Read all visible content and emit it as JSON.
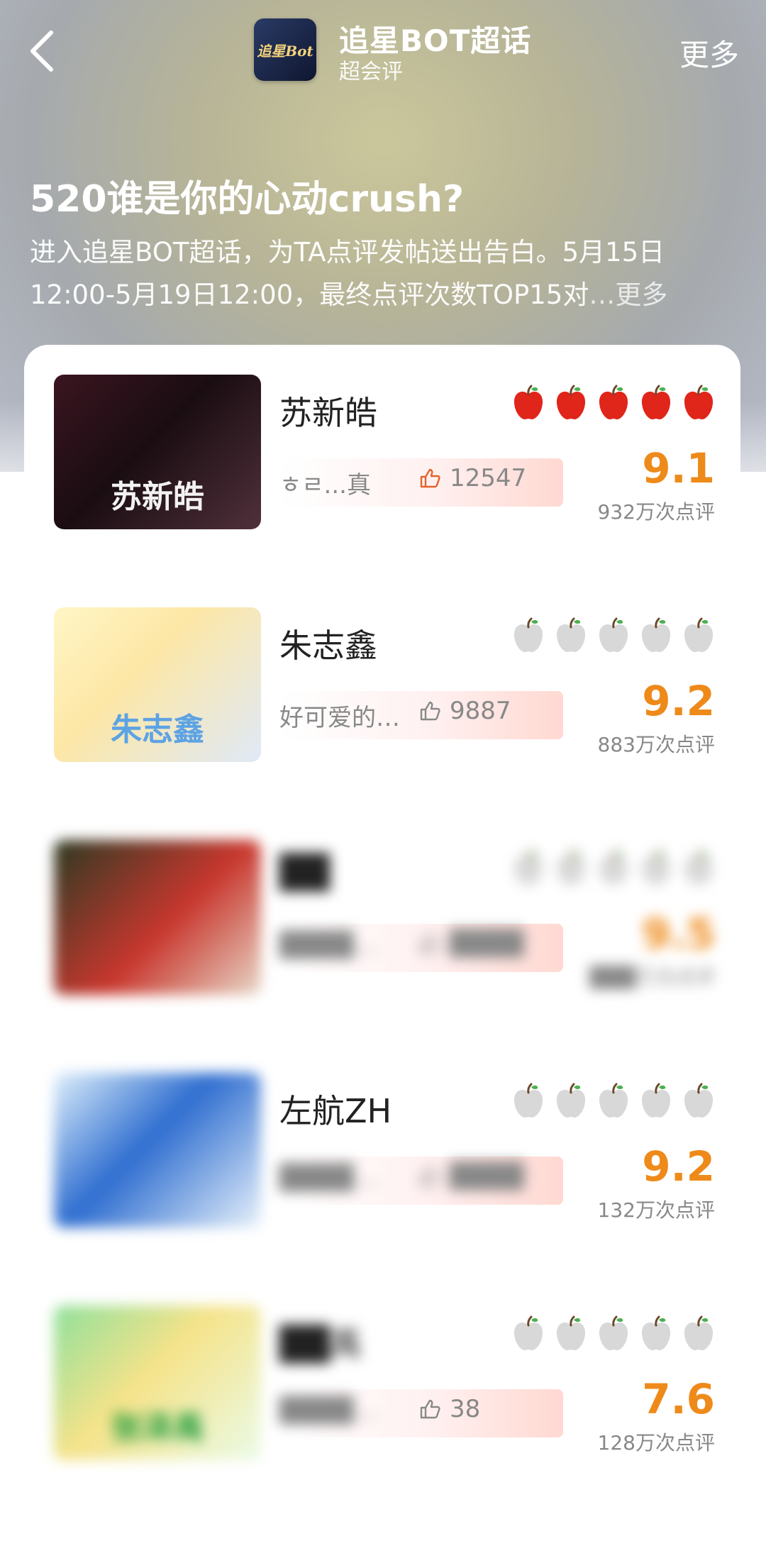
{
  "header": {
    "app_title": "追星BOT超话",
    "app_subtitle": "超会评",
    "more": "更多",
    "logo_text": "追星Bot"
  },
  "event": {
    "title": "520谁是你的心动crush?",
    "description": "进入追星BOT超话，为TA点评发帖送出告白。5月15日12:00-5月19日12:00，最终点评次数TOP15对",
    "more_link": "…更多"
  },
  "entries": [
    {
      "name": "苏新皓",
      "score": "9.1",
      "count": "932万次点评",
      "comment": "ㅎㄹ...真",
      "likes": "12547",
      "apples_red": 5,
      "thumb_text": "苏新皓"
    },
    {
      "name": "朱志鑫",
      "score": "9.2",
      "count": "883万次点评",
      "comment": "好可爱的…",
      "likes": "9887",
      "apples_red": 0,
      "thumb_text": "朱志鑫"
    },
    {
      "name": "",
      "score": "",
      "count": "",
      "comment": "",
      "likes": "",
      "apples_red": 0,
      "thumb_text": ""
    },
    {
      "name": "左航ZH",
      "score": "9.2",
      "count": "132万次点评",
      "comment": "",
      "likes": "",
      "apples_red": 0,
      "thumb_text": ""
    },
    {
      "name": "",
      "score": "7.6",
      "count": "128万次点评",
      "comment": "",
      "likes": "38",
      "apples_red": 0,
      "thumb_text": "张泽禹"
    }
  ],
  "colors": {
    "score": "#ee8a1a",
    "apple_red": "#e0251a",
    "apple_gray": "#d8d8d8"
  }
}
